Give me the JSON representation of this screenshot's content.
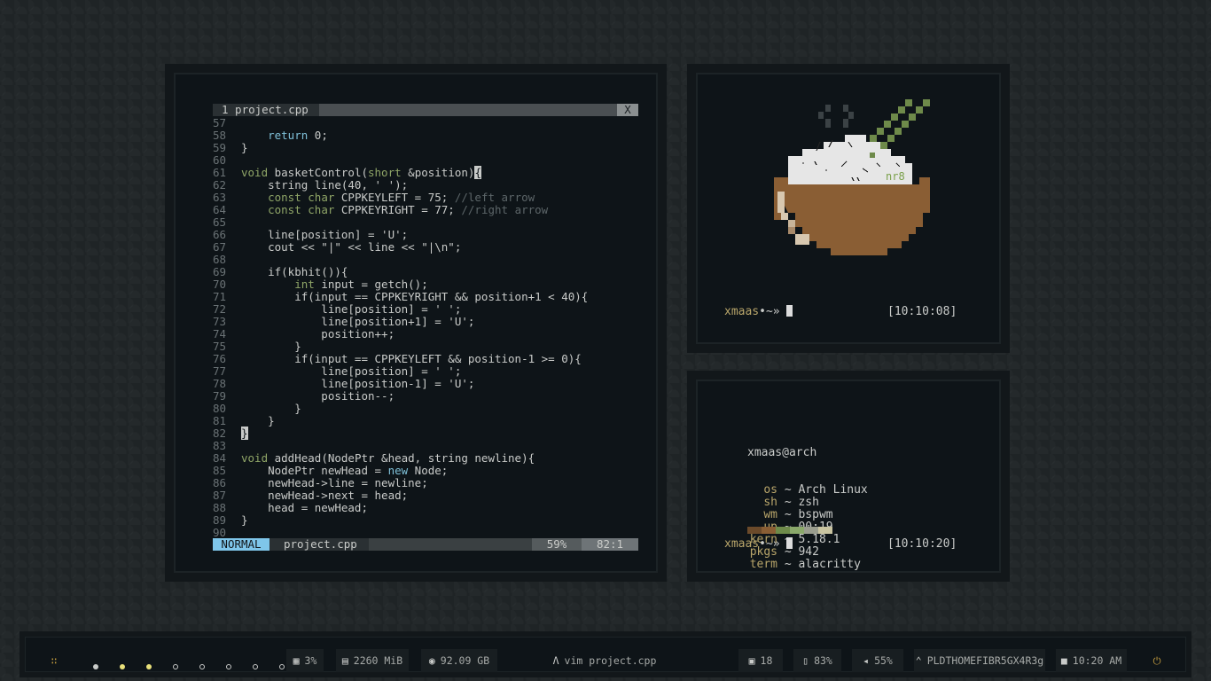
{
  "vim": {
    "tab_label": "1 project.cpp",
    "tab_close": "X",
    "mode": "NORMAL",
    "file": "project.cpp",
    "percent": "59%",
    "position": "82:1"
  },
  "code_lines": [
    {
      "n": "57",
      "t": ""
    },
    {
      "n": "58",
      "t": "    <span class=\"kw2\">return</span> 0;"
    },
    {
      "n": "59",
      "t": "}"
    },
    {
      "n": "60",
      "t": ""
    },
    {
      "n": "61",
      "t": "<span class=\"kw\">void</span> basketControl(<span class=\"kw\">short</span> &amp;position)<span class=\"cur\">{</span>"
    },
    {
      "n": "62",
      "t": "    string line(40, ' ');"
    },
    {
      "n": "63",
      "t": "    <span class=\"kw\">const char</span> CPPKEYLEFT = 75; <span class=\"cm\">//left arrow</span>"
    },
    {
      "n": "64",
      "t": "    <span class=\"kw\">const char</span> CPPKEYRIGHT = 77; <span class=\"cm\">//right arrow</span>"
    },
    {
      "n": "65",
      "t": ""
    },
    {
      "n": "66",
      "t": "    line[position] = 'U';"
    },
    {
      "n": "67",
      "t": "    cout &lt;&lt; \"|\" &lt;&lt; line &lt;&lt; \"|\\n\";"
    },
    {
      "n": "68",
      "t": ""
    },
    {
      "n": "69",
      "t": "    if(kbhit()){"
    },
    {
      "n": "70",
      "t": "        <span class=\"kw\">int</span> input = getch();"
    },
    {
      "n": "71",
      "t": "        if(input == CPPKEYRIGHT &amp;&amp; position+1 &lt; 40){"
    },
    {
      "n": "72",
      "t": "            line[position] = ' ';"
    },
    {
      "n": "73",
      "t": "            line[position+1] = 'U';"
    },
    {
      "n": "74",
      "t": "            position++;"
    },
    {
      "n": "75",
      "t": "        }"
    },
    {
      "n": "76",
      "t": "        if(input == CPPKEYLEFT &amp;&amp; position-1 &gt;= 0){"
    },
    {
      "n": "77",
      "t": "            line[position] = ' ';"
    },
    {
      "n": "78",
      "t": "            line[position-1] = 'U';"
    },
    {
      "n": "79",
      "t": "            position--;"
    },
    {
      "n": "80",
      "t": "        }"
    },
    {
      "n": "81",
      "t": "    }"
    },
    {
      "n": "82",
      "t": "<span class=\"cur\">}</span>"
    },
    {
      "n": "83",
      "t": ""
    },
    {
      "n": "84",
      "t": "<span class=\"kw\">void</span> addHead(NodePtr &amp;head, string newline){"
    },
    {
      "n": "85",
      "t": "    NodePtr newHead = <span class=\"kw2\">new</span> Node;"
    },
    {
      "n": "86",
      "t": "    newHead-&gt;line = newline;"
    },
    {
      "n": "87",
      "t": "    newHead-&gt;next = head;"
    },
    {
      "n": "88",
      "t": "    head = newHead;"
    },
    {
      "n": "89",
      "t": "}"
    },
    {
      "n": "90",
      "t": ""
    }
  ],
  "term_top": {
    "art_label": "nr8",
    "prompt_user": "xmaas",
    "prompt_sep": "•~»",
    "time": "[10:10:08]"
  },
  "term_bottom": {
    "title": "xmaas@arch",
    "info": [
      {
        "key": "os",
        "val": "Arch Linux"
      },
      {
        "key": "sh",
        "val": "zsh"
      },
      {
        "key": "wm",
        "val": "bspwm"
      },
      {
        "key": "up",
        "val": "00:19"
      },
      {
        "key": "kern",
        "val": "5.18.1"
      },
      {
        "key": "pkgs",
        "val": "942"
      },
      {
        "key": "term",
        "val": "alacritty"
      }
    ],
    "tilde": "~",
    "palette": [
      "#6b4a2a",
      "#8a5e34",
      "#6e8a4a",
      "#8aa86a",
      "#9a9d8e",
      "#c9c4a0"
    ],
    "prompt_user": "xmaas",
    "prompt_sep": "•~»",
    "time": "[10:10:20]"
  },
  "bar": {
    "menu_icon": "grid-icon",
    "workspaces": [
      {
        "state": "occupied",
        "color": "#c9cbc9"
      },
      {
        "state": "active",
        "color": "#e8e07a"
      },
      {
        "state": "active",
        "color": "#e8e07a"
      },
      {
        "state": "empty",
        "color": "#c9cbc9"
      },
      {
        "state": "empty",
        "color": "#c9cbc9"
      },
      {
        "state": "empty",
        "color": "#c9cbc9"
      },
      {
        "state": "empty",
        "color": "#c9cbc9"
      },
      {
        "state": "empty",
        "color": "#c9cbc9"
      }
    ],
    "cpu": "3%",
    "mem": "2260 MiB",
    "disk": "92.09 GB",
    "window_title": "vim project.cpp",
    "updates": "18",
    "battery": "83%",
    "volume": "55%",
    "wifi": "PLDTHOMEFIBR5GX4R3g",
    "clock": "10:20 AM",
    "power_color": "#c8a040"
  }
}
